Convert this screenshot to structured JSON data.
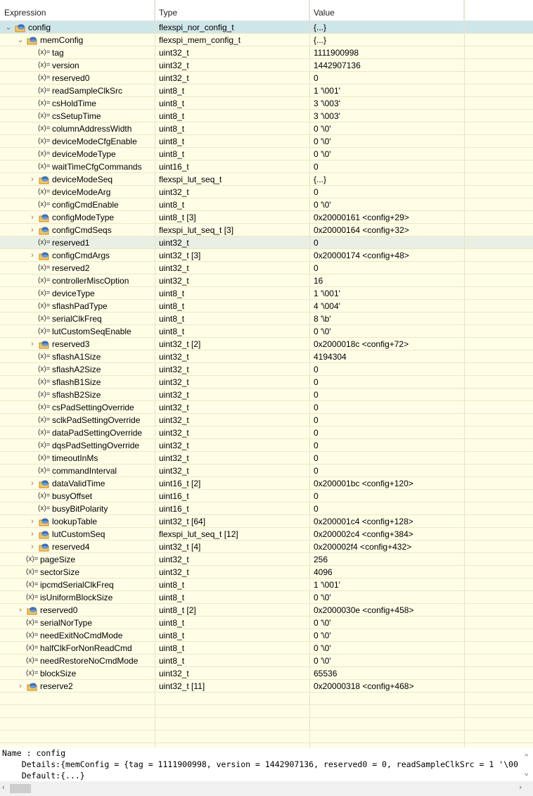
{
  "columns": [
    "Expression",
    "Type",
    "Value"
  ],
  "rows": [
    {
      "d": 0,
      "exp": "open",
      "name": "config",
      "type": "flexspi_nor_config_t",
      "value": "{...}",
      "state": "selected"
    },
    {
      "d": 1,
      "exp": "open",
      "name": "memConfig",
      "type": "flexspi_mem_config_t",
      "value": "{...}"
    },
    {
      "d": 2,
      "name": "tag",
      "type": "uint32_t",
      "value": "1111900998"
    },
    {
      "d": 2,
      "name": "version",
      "type": "uint32_t",
      "value": "1442907136"
    },
    {
      "d": 2,
      "name": "reserved0",
      "type": "uint32_t",
      "value": "0"
    },
    {
      "d": 2,
      "name": "readSampleClkSrc",
      "type": "uint8_t",
      "value": "1 '\\001'"
    },
    {
      "d": 2,
      "name": "csHoldTime",
      "type": "uint8_t",
      "value": "3 '\\003'"
    },
    {
      "d": 2,
      "name": "csSetupTime",
      "type": "uint8_t",
      "value": "3 '\\003'"
    },
    {
      "d": 2,
      "name": "columnAddressWidth",
      "type": "uint8_t",
      "value": "0 '\\0'"
    },
    {
      "d": 2,
      "name": "deviceModeCfgEnable",
      "type": "uint8_t",
      "value": "0 '\\0'"
    },
    {
      "d": 2,
      "name": "deviceModeType",
      "type": "uint8_t",
      "value": "0 '\\0'"
    },
    {
      "d": 2,
      "name": "waitTimeCfgCommands",
      "type": "uint16_t",
      "value": "0"
    },
    {
      "d": 2,
      "exp": "closed",
      "name": "deviceModeSeq",
      "type": "flexspi_lut_seq_t",
      "value": "{...}"
    },
    {
      "d": 2,
      "name": "deviceModeArg",
      "type": "uint32_t",
      "value": "0"
    },
    {
      "d": 2,
      "name": "configCmdEnable",
      "type": "uint8_t",
      "value": "0 '\\0'"
    },
    {
      "d": 2,
      "exp": "closed",
      "name": "configModeType",
      "type": "uint8_t [3]",
      "value": "0x20000161 <config+29>"
    },
    {
      "d": 2,
      "exp": "closed",
      "name": "configCmdSeqs",
      "type": "flexspi_lut_seq_t [3]",
      "value": "0x20000164 <config+32>"
    },
    {
      "d": 2,
      "name": "reserved1",
      "type": "uint32_t",
      "value": "0",
      "state": "hover"
    },
    {
      "d": 2,
      "exp": "closed",
      "name": "configCmdArgs",
      "type": "uint32_t [3]",
      "value": "0x20000174 <config+48>"
    },
    {
      "d": 2,
      "name": "reserved2",
      "type": "uint32_t",
      "value": "0"
    },
    {
      "d": 2,
      "name": "controllerMiscOption",
      "type": "uint32_t",
      "value": "16"
    },
    {
      "d": 2,
      "name": "deviceType",
      "type": "uint8_t",
      "value": "1 '\\001'"
    },
    {
      "d": 2,
      "name": "sflashPadType",
      "type": "uint8_t",
      "value": "4 '\\004'"
    },
    {
      "d": 2,
      "name": "serialClkFreq",
      "type": "uint8_t",
      "value": "8 '\\b'"
    },
    {
      "d": 2,
      "name": "lutCustomSeqEnable",
      "type": "uint8_t",
      "value": "0 '\\0'"
    },
    {
      "d": 2,
      "exp": "closed",
      "name": "reserved3",
      "type": "uint32_t [2]",
      "value": "0x2000018c <config+72>"
    },
    {
      "d": 2,
      "name": "sflashA1Size",
      "type": "uint32_t",
      "value": "4194304"
    },
    {
      "d": 2,
      "name": "sflashA2Size",
      "type": "uint32_t",
      "value": "0"
    },
    {
      "d": 2,
      "name": "sflashB1Size",
      "type": "uint32_t",
      "value": "0"
    },
    {
      "d": 2,
      "name": "sflashB2Size",
      "type": "uint32_t",
      "value": "0"
    },
    {
      "d": 2,
      "name": "csPadSettingOverride",
      "type": "uint32_t",
      "value": "0"
    },
    {
      "d": 2,
      "name": "sclkPadSettingOverride",
      "type": "uint32_t",
      "value": "0"
    },
    {
      "d": 2,
      "name": "dataPadSettingOverride",
      "type": "uint32_t",
      "value": "0"
    },
    {
      "d": 2,
      "name": "dqsPadSettingOverride",
      "type": "uint32_t",
      "value": "0"
    },
    {
      "d": 2,
      "name": "timeoutInMs",
      "type": "uint32_t",
      "value": "0"
    },
    {
      "d": 2,
      "name": "commandInterval",
      "type": "uint32_t",
      "value": "0"
    },
    {
      "d": 2,
      "exp": "closed",
      "name": "dataValidTime",
      "type": "uint16_t [2]",
      "value": "0x200001bc <config+120>"
    },
    {
      "d": 2,
      "name": "busyOffset",
      "type": "uint16_t",
      "value": "0"
    },
    {
      "d": 2,
      "name": "busyBitPolarity",
      "type": "uint16_t",
      "value": "0"
    },
    {
      "d": 2,
      "exp": "closed",
      "name": "lookupTable",
      "type": "uint32_t [64]",
      "value": "0x200001c4 <config+128>"
    },
    {
      "d": 2,
      "exp": "closed",
      "name": "lutCustomSeq",
      "type": "flexspi_lut_seq_t [12]",
      "value": "0x200002c4 <config+384>"
    },
    {
      "d": 2,
      "exp": "closed",
      "name": "reserved4",
      "type": "uint32_t [4]",
      "value": "0x200002f4 <config+432>"
    },
    {
      "d": 1,
      "name": "pageSize",
      "type": "uint32_t",
      "value": "256"
    },
    {
      "d": 1,
      "name": "sectorSize",
      "type": "uint32_t",
      "value": "4096"
    },
    {
      "d": 1,
      "name": "ipcmdSerialClkFreq",
      "type": "uint8_t",
      "value": "1 '\\001'"
    },
    {
      "d": 1,
      "name": "isUniformBlockSize",
      "type": "uint8_t",
      "value": "0 '\\0'"
    },
    {
      "d": 1,
      "exp": "closed",
      "name": "reserved0",
      "type": "uint8_t [2]",
      "value": "0x2000030e <config+458>"
    },
    {
      "d": 1,
      "name": "serialNorType",
      "type": "uint8_t",
      "value": "0 '\\0'"
    },
    {
      "d": 1,
      "name": "needExitNoCmdMode",
      "type": "uint8_t",
      "value": "0 '\\0'"
    },
    {
      "d": 1,
      "name": "halfClkForNonReadCmd",
      "type": "uint8_t",
      "value": "0 '\\0'"
    },
    {
      "d": 1,
      "name": "needRestoreNoCmdMode",
      "type": "uint8_t",
      "value": "0 '\\0'"
    },
    {
      "d": 1,
      "name": "blockSize",
      "type": "uint32_t",
      "value": "65536"
    },
    {
      "d": 1,
      "exp": "closed",
      "name": "reserve2",
      "type": "uint32_t [11]",
      "value": "0x20000318 <config+468>"
    }
  ],
  "variable_icon": "(x)=",
  "details": {
    "name_line": "Name : config",
    "details_line": "    Details:{memConfig = {tag = 1111900998, version = 1442907136, reserved0 = 0, readSampleClkSrc = 1 '\\00",
    "default_line": "    Default:{...}"
  }
}
